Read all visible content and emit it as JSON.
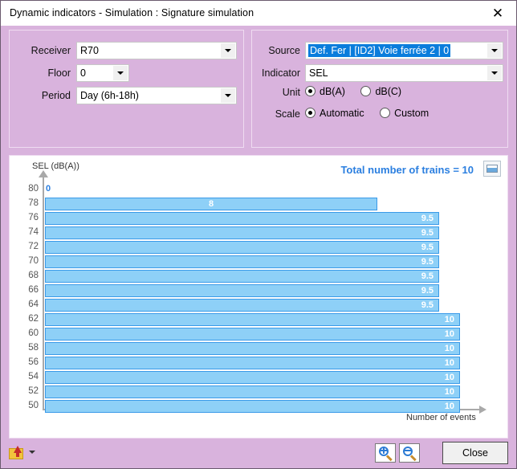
{
  "window": {
    "title": "Dynamic indicators - Simulation : Signature simulation",
    "close_icon": "✕"
  },
  "left_panel": {
    "receiver": {
      "label": "Receiver",
      "value": "R70"
    },
    "floor": {
      "label": "Floor",
      "value": "0"
    },
    "period": {
      "label": "Period",
      "value": "Day (6h-18h)"
    }
  },
  "right_panel": {
    "source": {
      "label": "Source",
      "value": "Def. Fer | [ID2] Voie ferrée 2 | 0"
    },
    "indicator": {
      "label": "Indicator",
      "value": "SEL"
    },
    "unit": {
      "label": "Unit",
      "options": [
        {
          "label": "dB(A)",
          "selected": true
        },
        {
          "label": "dB(C)",
          "selected": false
        }
      ]
    },
    "scale": {
      "label": "Scale",
      "options": [
        {
          "label": "Automatic",
          "selected": true
        },
        {
          "label": "Custom",
          "selected": false
        }
      ]
    }
  },
  "chart_panel": {
    "total_trains_text": "Total number of trains = 10",
    "image_button_name": "export-image"
  },
  "footer": {
    "export_label": "export-dropdown",
    "zoom_in_label": "zoom-in",
    "zoom_out_label": "zoom-out",
    "close_label": "Close"
  },
  "chart_data": {
    "type": "bar",
    "orientation": "horizontal",
    "title": "",
    "xlabel": "Number of events",
    "ylabel": "SEL (dB(A))",
    "categories": [
      80,
      78,
      76,
      74,
      72,
      70,
      68,
      66,
      64,
      62,
      60,
      58,
      56,
      54,
      52,
      50
    ],
    "values": [
      0,
      8,
      9.5,
      9.5,
      9.5,
      9.5,
      9.5,
      9.5,
      9.5,
      10,
      10,
      10,
      10,
      10,
      10,
      10
    ],
    "value_labels": [
      "0",
      "8",
      "9.5",
      "9.5",
      "9.5",
      "9.5",
      "9.5",
      "9.5",
      "9.5",
      "10",
      "10",
      "10",
      "10",
      "10",
      "10",
      "10"
    ],
    "xlim": [
      0,
      10.5
    ],
    "ylim": [
      50,
      80
    ],
    "grid": false,
    "legend": false,
    "bar_color": "#8ed0f7",
    "bar_border_color": "#3a9ae8",
    "label_color": "#ffffff",
    "zero_label_color": "#2b7fe0"
  }
}
